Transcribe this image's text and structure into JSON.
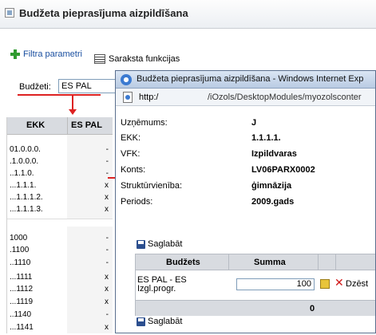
{
  "page": {
    "title": "Budžeta pieprasījuma aizpildīšana"
  },
  "toolbar": {
    "filter_label": "Filtra parametri",
    "list_functions_label": "Saraksta funkcijas"
  },
  "filter": {
    "budget_label": "Budžeti:",
    "budget_value": "ES PAL"
  },
  "left_table": {
    "headers": [
      "EKK",
      "ES PAL"
    ],
    "rows_top": [
      {
        "code": "01.0.0.0.",
        "mark": "-"
      },
      {
        "code": ".1.0.0.0.",
        "mark": "-"
      },
      {
        "code": "..1.1.0.",
        "mark": "-"
      },
      {
        "code": "...1.1.1.",
        "mark": "x"
      },
      {
        "code": "...1.1.1.2.",
        "mark": "x"
      },
      {
        "code": "...1.1.1.3.",
        "mark": "x"
      }
    ],
    "rows_bottom": [
      {
        "code": "1000",
        "mark": "-"
      },
      {
        "code": ".1100",
        "mark": "-"
      },
      {
        "code": "..1110",
        "mark": "-"
      },
      {
        "code": "...1111",
        "mark": "x"
      },
      {
        "code": "...1112",
        "mark": "x"
      },
      {
        "code": "...1119",
        "mark": "x"
      },
      {
        "code": "..1140",
        "mark": "-"
      },
      {
        "code": "...1141",
        "mark": "x"
      }
    ]
  },
  "popup": {
    "window_title": "Budžeta pieprasījuma aizpildīšana - Windows Internet Exp",
    "url_prefix": "http:/",
    "url_path": "/iOzols/DesktopModules/myozolsconter",
    "fields": [
      {
        "label": "Uzņēmums:",
        "value": "J"
      },
      {
        "label": "EKK:",
        "value": "1.1.1.1."
      },
      {
        "label": "VFK:",
        "value": "Izpildvaras"
      },
      {
        "label": "Konts:",
        "value": "LV06PARX0002"
      },
      {
        "label": "Struktūrvienība:",
        "value": "ģimnāzija"
      },
      {
        "label": "Periods:",
        "value": "2009.gads"
      }
    ],
    "save_label": "Saglabāt",
    "budget_table": {
      "headers": [
        "Budžets",
        "Summa"
      ],
      "row_name_1": "ES PAL          - ES",
      "row_name_2": "Izgl.progr.",
      "amount": "100",
      "delete_label": "Dzēst",
      "total": "0"
    }
  }
}
